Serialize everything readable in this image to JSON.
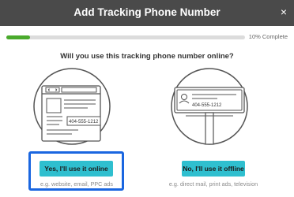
{
  "dialog": {
    "title": "Add Tracking Phone Number",
    "close_icon": "close-icon",
    "close_glyph": "×"
  },
  "progress": {
    "percent": 10,
    "label": "10% Complete",
    "fill_color": "#4aaa2c"
  },
  "question": "Will you use this tracking phone number online?",
  "options": {
    "online": {
      "illustration": "browser-window-icon",
      "phone_sample": "404-555-1212",
      "button_label": "Yes, I'll use it online",
      "hint": "e.g. website, email, PPC ads",
      "selected": true
    },
    "offline": {
      "illustration": "billboard-icon",
      "phone_sample": "404-555-1212",
      "button_label": "No, I'll use it offline",
      "hint": "e.g. direct mail, print ads, television"
    }
  },
  "colors": {
    "header_bg": "#4a4a4a",
    "button_bg": "#2fbfcf",
    "selection_border": "#1a66e0"
  }
}
